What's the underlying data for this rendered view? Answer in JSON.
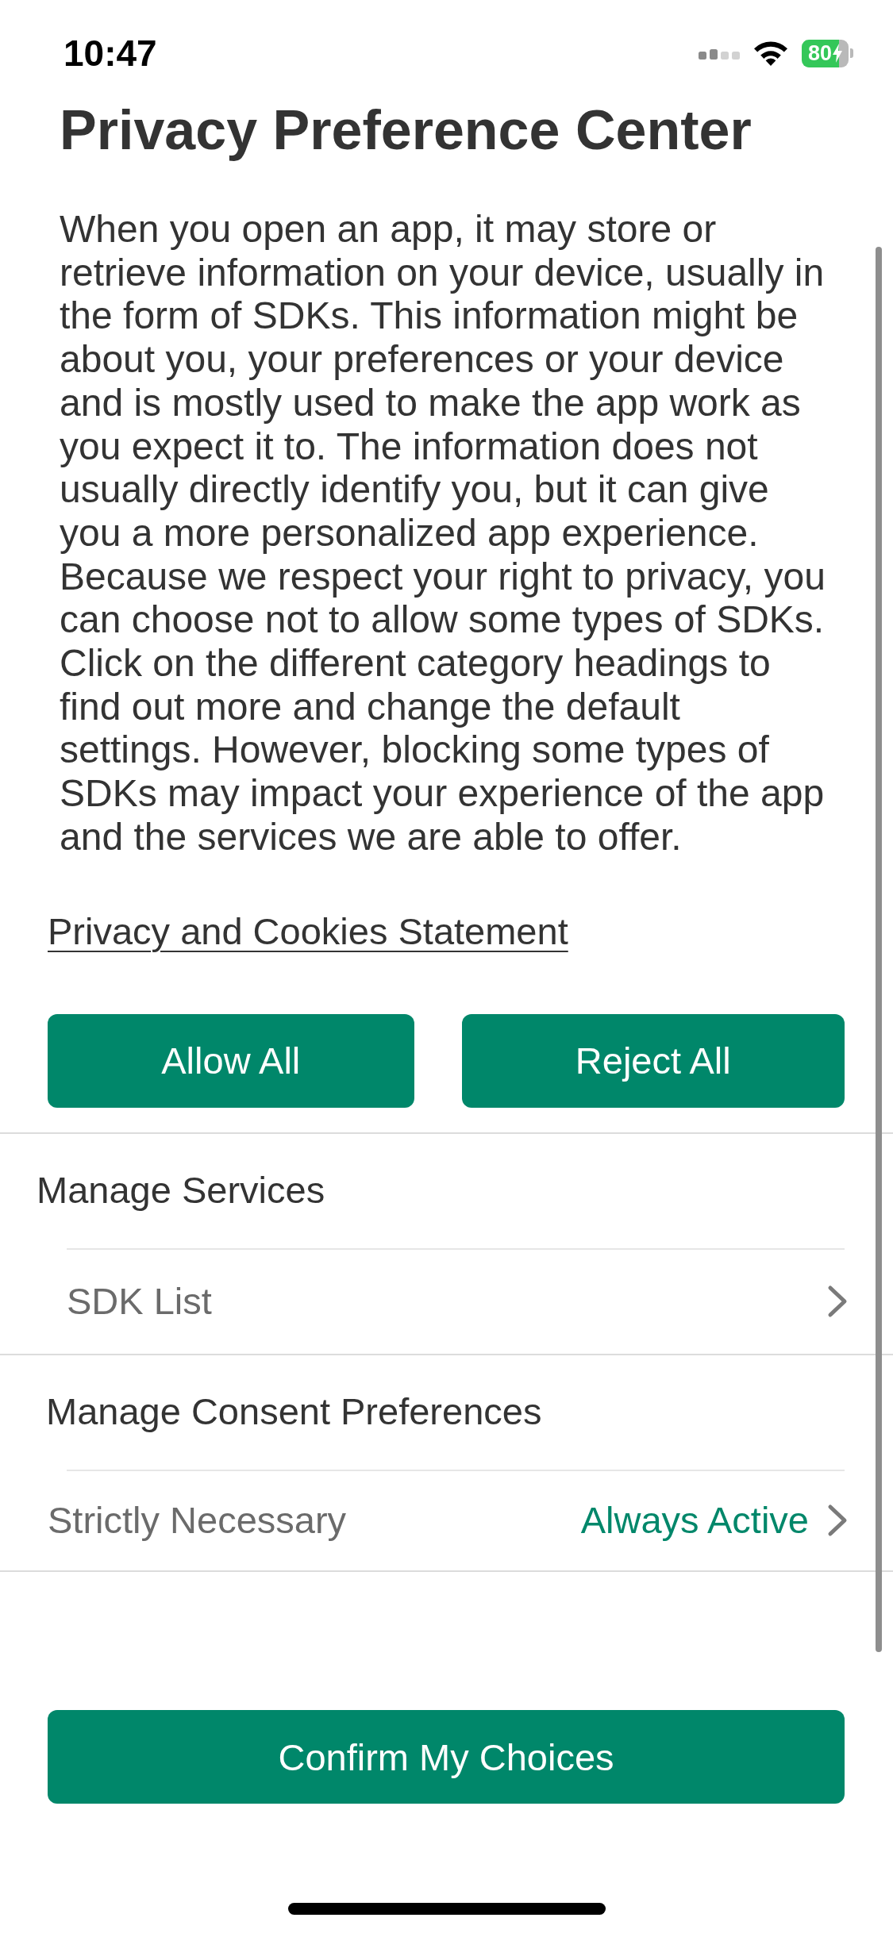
{
  "status_bar": {
    "time": "10:47",
    "battery": "80"
  },
  "title": "Privacy Preference Center",
  "description": "When you open an app, it may store or retrieve information on your device, usually in the form of SDKs. This information might be about you, your preferences or your device and is mostly used to make the app work as you expect it to. The information does not usually directly identify you, but it can give you a more personalized app experience. Because we respect your right to privacy, you can choose not to allow some types of SDKs. Click on the different category headings to find out more and change the default settings. However, blocking some types of SDKs may impact your experience of the app and the services we are able to offer.",
  "policy_link": "Privacy and Cookies Statement",
  "actions": [
    {
      "label": "Allow All"
    },
    {
      "label": "Reject All"
    }
  ],
  "sections": [
    {
      "title": "Manage Services",
      "items": [
        {
          "label": "SDK List"
        }
      ]
    },
    {
      "title": "Manage Consent Preferences",
      "items": [
        {
          "label": "Strictly Necessary",
          "status": "Always Active"
        }
      ]
    }
  ],
  "confirm_button": {
    "label": "Confirm My Choices"
  }
}
